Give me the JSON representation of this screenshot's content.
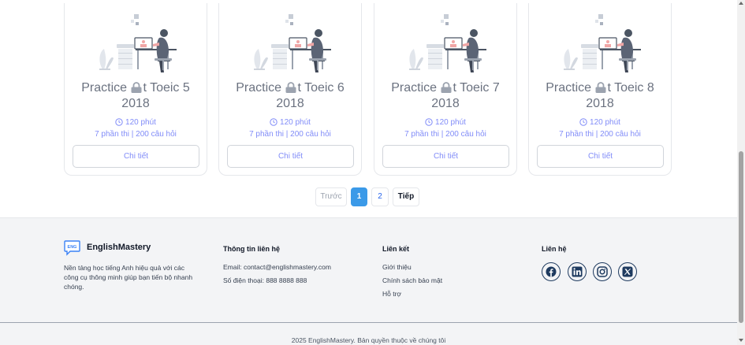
{
  "cards": [
    {
      "title_line1": "Practice ",
      "title_line1b": "t Toeic 5",
      "title_line2": "2018",
      "duration": "120 phút",
      "parts": "7 phần thi | 200 câu hỏi",
      "button": "Chi tiết"
    },
    {
      "title_line1": "Practice ",
      "title_line1b": "t Toeic 6",
      "title_line2": "2018",
      "duration": "120 phút",
      "parts": "7 phần thi | 200 câu hỏi",
      "button": "Chi tiết"
    },
    {
      "title_line1": "Practice ",
      "title_line1b": "t Toeic 7",
      "title_line2": "2018",
      "duration": "120 phút",
      "parts": "7 phần thi | 200 câu hỏi",
      "button": "Chi tiết"
    },
    {
      "title_line1": "Practice ",
      "title_line1b": "t Toeic 8",
      "title_line2": "2018",
      "duration": "120 phút",
      "parts": "7 phần thi | 200 câu hỏi",
      "button": "Chi tiết"
    }
  ],
  "pagination": {
    "prev": "Trước",
    "pages": [
      "1",
      "2"
    ],
    "current": "1",
    "next": "Tiếp"
  },
  "footer": {
    "brand": {
      "logo_text": "ENG",
      "name": "EnglishMastery",
      "description": "Nền tảng học tiếng Anh hiệu quả với các công cụ thông minh giúp bạn tiến bộ nhanh chóng."
    },
    "contact": {
      "title": "Thông tin liên hệ",
      "email": "Email: contact@englishmastery.com",
      "phone": "Số điện thoại: 888 8888 888"
    },
    "links": {
      "title": "Liên kết",
      "items": [
        "Giới thiệu",
        "Chính sách bảo mật",
        "Hỗ trợ"
      ]
    },
    "social": {
      "title": "Liên hệ",
      "icons": [
        "facebook-icon",
        "linkedin-icon",
        "instagram-icon",
        "x-icon"
      ]
    },
    "copyright": "2025 EnglishMastery. Bản quyền thuộc về chúng tôi"
  },
  "colors": {
    "accent": "#3b9ae8",
    "muted_accent": "#818cf8",
    "footer_bg": "#f3f4f6",
    "social": "#1e3a5f"
  }
}
